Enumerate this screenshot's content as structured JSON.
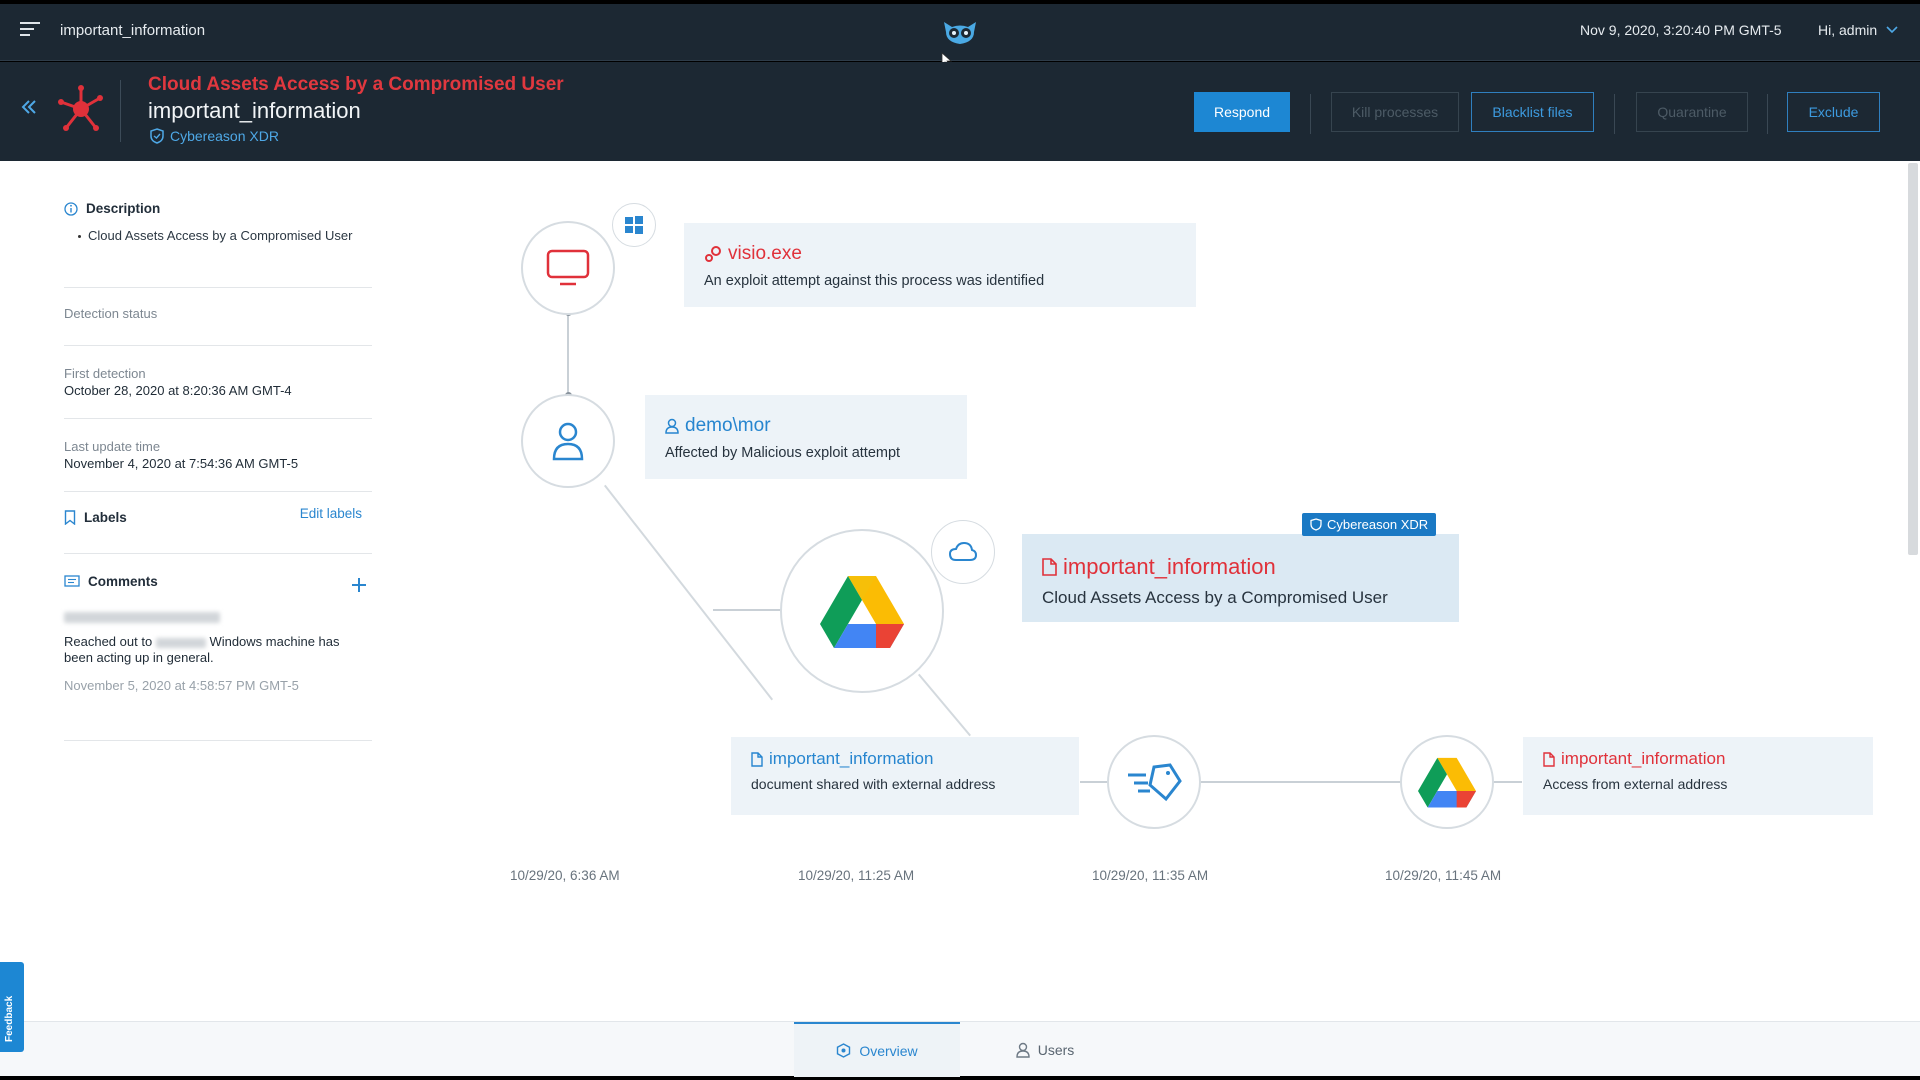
{
  "topbar": {
    "title": "important_information",
    "datetime": "Nov 9, 2020, 3:20:40 PM GMT-5",
    "user": "Hi, admin"
  },
  "header": {
    "alert_type": "Cloud Assets Access by a Compromised User",
    "alert_name": "important_information",
    "source": "Cybereason XDR",
    "buttons": {
      "respond": "Respond",
      "kill": "Kill processes",
      "blacklist": "Blacklist files",
      "quarantine": "Quarantine",
      "exclude": "Exclude"
    }
  },
  "panel": {
    "description_title": "Description",
    "description_text": "Cloud Assets Access by a Compromised User",
    "detection_status_label": "Detection status",
    "first_detection_label": "First detection",
    "first_detection_value": "October 28, 2020 at 8:20:36 AM GMT-4",
    "last_update_label": "Last update time",
    "last_update_value": "November 4, 2020 at 7:54:36 AM GMT-5",
    "labels_title": "Labels",
    "edit_labels": "Edit labels",
    "comments_title": "Comments",
    "comment_text_1": "Reached out to",
    "comment_text_2": "Windows machine has been acting up in general.",
    "comment_time": "November 5, 2020 at 4:58:57 PM GMT-5"
  },
  "graph": {
    "visio": {
      "title": "visio.exe",
      "desc": "An exploit attempt against this process was identified"
    },
    "user": {
      "title": "demo\\mor",
      "desc": "Affected by Malicious exploit attempt"
    },
    "main": {
      "tag": "Cybereason XDR",
      "title": "important_information",
      "desc": "Cloud Assets Access by a Compromised User"
    },
    "shared": {
      "title": "important_information",
      "desc": "document shared with external address"
    },
    "access": {
      "title": "important_information",
      "desc": "Access from external address"
    },
    "timestamps": [
      "10/29/20, 6:36 AM",
      "10/29/20, 11:25 AM",
      "10/29/20, 11:35 AM",
      "10/29/20, 11:45 AM"
    ]
  },
  "bottom": {
    "tabs": [
      "Overview",
      "Users"
    ],
    "feedback": "Feedback"
  },
  "colors": {
    "accent": "#1d87d3",
    "alert": "#e0383f",
    "header_bg": "#1c2833"
  }
}
